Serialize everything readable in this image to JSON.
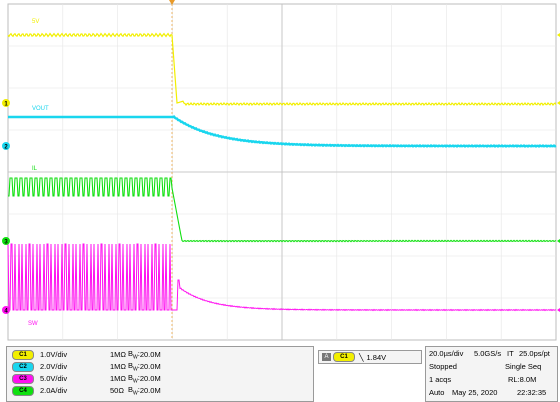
{
  "channels": [
    {
      "id": "C1",
      "label": "5V",
      "scale": "1.0V/div",
      "impedance": "1MΩ",
      "bw": "20.0M",
      "color": "#f2ef00",
      "marker": "1"
    },
    {
      "id": "C2",
      "label": "VOUT",
      "scale": "2.0V/div",
      "impedance": "1MΩ",
      "bw": "20.0M",
      "color": "#19d6ee",
      "marker": "2"
    },
    {
      "id": "C3",
      "label": "IL",
      "scale": "5.0V/div",
      "impedance": "1MΩ",
      "bw": "20.0M",
      "color": "#10e010",
      "marker": "3"
    },
    {
      "id": "C4",
      "label": "SW",
      "scale": "2.0A/div",
      "impedance": "50Ω",
      "bw": "20.0M",
      "color": "#ff10f0",
      "marker": "4"
    }
  ],
  "trigger": {
    "source": "C1",
    "level": "1.84V",
    "mode_letter": "A"
  },
  "acquisition": {
    "timebase": "20.0µs/div",
    "sample_rate": "5.0GS/s",
    "it_label": "IT",
    "interval": "25.0ps/pt",
    "state": "Stopped",
    "sequence": "Single Seq",
    "acqs": "1 acqs",
    "record": "RL:8.0M",
    "mode": "Auto",
    "date": "May 25, 2020",
    "time": "22:32:35"
  },
  "colors": {
    "grid": "#bdbdbd",
    "grid_minor": "#e6e6e6",
    "yellow": "#f2ef00",
    "cyan": "#19d6ee",
    "green": "#10e010",
    "magenta": "#ff10f0",
    "trigger": "#e89a2a"
  }
}
